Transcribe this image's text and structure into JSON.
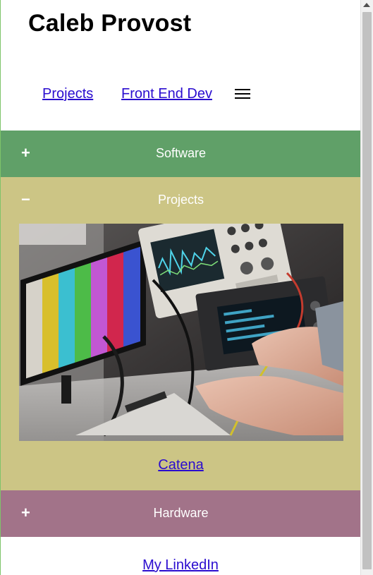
{
  "header": {
    "title": "Caleb Provost"
  },
  "nav": {
    "items": [
      {
        "label": "Projects"
      },
      {
        "label": "Front End Dev"
      }
    ],
    "menu_icon": "hamburger-menu-icon"
  },
  "sections": {
    "software": {
      "sign": "+",
      "label": "Software",
      "color": "#60a068",
      "expanded": false
    },
    "projects": {
      "sign": "−",
      "label": "Projects",
      "color": "#ccc585",
      "expanded": true,
      "link_label": "Catena"
    },
    "hardware": {
      "sign": "+",
      "label": "Hardware",
      "color": "#a27389",
      "expanded": false
    }
  },
  "footer": {
    "link_label": "My LinkedIn"
  },
  "colors": {
    "link": "#2a0ccf"
  }
}
